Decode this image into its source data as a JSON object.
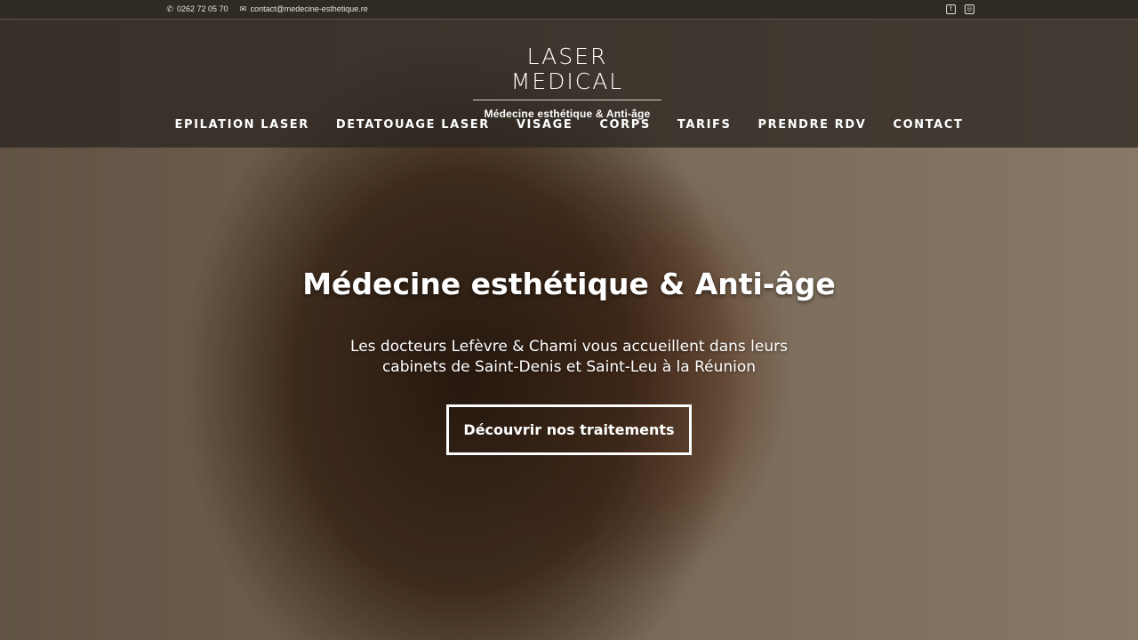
{
  "topbar": {
    "phone": "0262 72 05 70",
    "email": "contact@medecine-esthetique.re",
    "phone_icon": "phone-icon",
    "email_icon": "envelope-icon",
    "social": [
      {
        "name": "facebook-icon",
        "glyph": "f"
      },
      {
        "name": "instagram-icon",
        "glyph": "◎"
      }
    ]
  },
  "logo": {
    "title": "LASER MEDICAL",
    "subtitle": "Médecine esthétique & Anti-âge"
  },
  "nav": [
    {
      "label": "EPILATION LASER"
    },
    {
      "label": "DETATOUAGE LASER"
    },
    {
      "label": "VISAGE"
    },
    {
      "label": "CORPS"
    },
    {
      "label": "TARIFS"
    },
    {
      "label": "PRENDRE RDV"
    },
    {
      "label": "CONTACT"
    }
  ],
  "hero": {
    "title": "Médecine esthétique & Anti-âge",
    "text": "Les docteurs Lefèvre & Chami vous accueillent dans leurs cabinets de Saint-Denis et Saint-Leu à la Réunion",
    "cta": "Découvrir nos traitements"
  },
  "colors": {
    "header_bg": "#28231e",
    "topbar_bg": "#2f2a24",
    "text": "#ffffff"
  }
}
